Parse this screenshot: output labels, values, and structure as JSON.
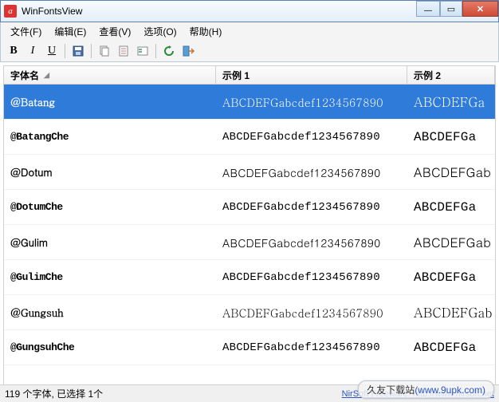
{
  "window": {
    "title": "WinFontsView",
    "icon_letter": "a"
  },
  "menu": {
    "items": [
      "文件(F)",
      "编辑(E)",
      "查看(V)",
      "选项(O)",
      "帮助(H)"
    ]
  },
  "toolbar": {
    "bold": "B",
    "italic": "I",
    "underline": "U",
    "icons": [
      "save-icon",
      "copy-icon",
      "properties-icon",
      "options-icon",
      "refresh-icon",
      "exit-icon"
    ]
  },
  "columns": {
    "name": "字体名",
    "sample1": "示例 1",
    "sample2": "示例 2"
  },
  "sample_text": "ABCDEFGabcdef1234567890",
  "sample_text_short": "ABCDEFGa",
  "sample_text_short2": "ABCDEFGab",
  "fonts": [
    {
      "name": "@Batang",
      "selected": true,
      "class": "f-serif"
    },
    {
      "name": "@BatangChe",
      "selected": false,
      "class": "f-mono"
    },
    {
      "name": "@Dotum",
      "selected": false,
      "class": "f-sans"
    },
    {
      "name": "@DotumChe",
      "selected": false,
      "class": "f-mono"
    },
    {
      "name": "@Gulim",
      "selected": false,
      "class": "f-sans"
    },
    {
      "name": "@GulimChe",
      "selected": false,
      "class": "f-mono"
    },
    {
      "name": "@Gungsuh",
      "selected": false,
      "class": "f-serif"
    },
    {
      "name": "@GungsuhChe",
      "selected": false,
      "class": "f-mono"
    }
  ],
  "statusbar": {
    "left": "119 个字体, 已选择 1个",
    "right": "NirSoft Freeware. http://www.nirsoft.net"
  },
  "watermark": {
    "cn": "久友下载站",
    "url": "(www.9upk.com)"
  }
}
